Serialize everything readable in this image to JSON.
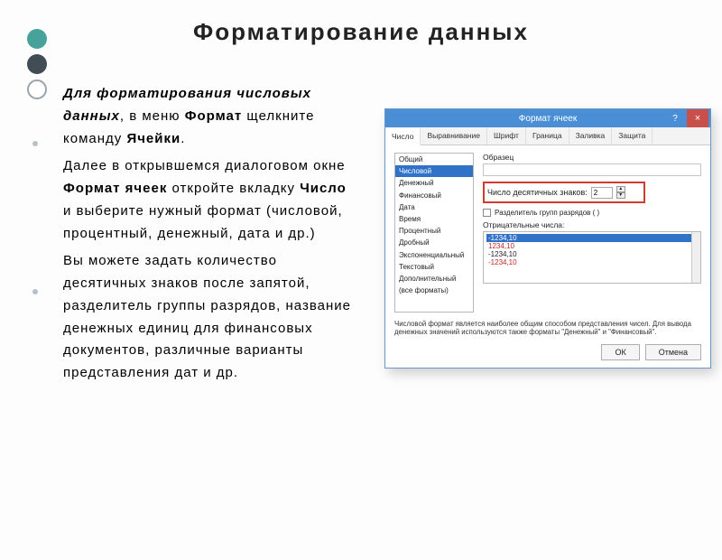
{
  "slide": {
    "title": "Форматирование  данных",
    "p1_intro": "Для форматирования числовых данных",
    "p1_rest": ", в меню ",
    "p1_b1": "Формат",
    "p1_rest2": " щелкните команду ",
    "p1_b2": "Ячейки",
    "p1_end": ".",
    "p2_a": "Далее в открывшемся диалоговом окне ",
    "p2_b1": "Формат ячеек",
    "p2_m": " откройте вкладку ",
    "p2_b2": "Число",
    "p2_e": " и выберите нужный формат (числовой, процентный, денежный, дата и др.)",
    "p3": "Вы можете задать количество десятичных знаков после запятой, разделитель группы разрядов, название денежных единиц для финансовых документов, различные варианты представления дат и др."
  },
  "dialog": {
    "title": "Формат ячеек",
    "help": "?",
    "close": "×",
    "tabs": [
      "Число",
      "Выравнивание",
      "Шрифт",
      "Граница",
      "Заливка",
      "Защита"
    ],
    "categories": [
      "Общий",
      "Числовой",
      "Денежный",
      "Финансовый",
      "Дата",
      "Время",
      "Процентный",
      "Дробный",
      "Экспоненциальный",
      "Текстовый",
      "Дополнительный",
      "(все форматы)"
    ],
    "selected_category_index": 1,
    "sample_label": "Образец",
    "decimal_label": "Число десятичных знаков:",
    "decimal_value": "2",
    "sep_label": "Разделитель групп разрядов ( )",
    "neg_label": "Отрицательные числа:",
    "neg_examples": [
      "-1234,10",
      "1234,10",
      "-1234,10",
      "-1234,10"
    ],
    "neg_selected_index": 0,
    "description": "Числовой формат является наиболее общим способом представления чисел. Для вывода денежных значений используются также форматы \"Денежный\" и \"Финансовый\".",
    "ok": "ОК",
    "cancel": "Отмена"
  }
}
